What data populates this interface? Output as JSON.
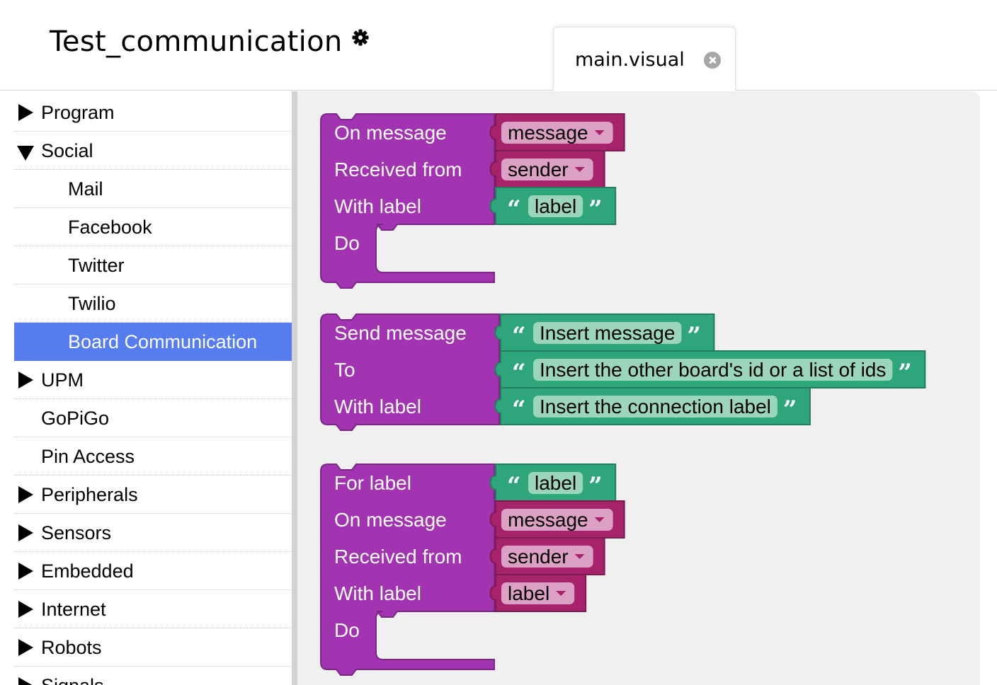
{
  "header": {
    "project_title": "Test_communication",
    "settings_icon": "gear-icon",
    "tab": {
      "label": "main.visual",
      "close_icon": "close-icon"
    }
  },
  "sidebar": {
    "items": [
      {
        "label": "Program",
        "state": "collapsed"
      },
      {
        "label": "Social",
        "state": "expanded"
      },
      {
        "label": "Mail",
        "state": "child"
      },
      {
        "label": "Facebook",
        "state": "child"
      },
      {
        "label": "Twitter",
        "state": "child"
      },
      {
        "label": "Twilio",
        "state": "child"
      },
      {
        "label": "Board Communication",
        "state": "child-selected"
      },
      {
        "label": "UPM",
        "state": "collapsed"
      },
      {
        "label": "GoPiGo",
        "state": "leaf"
      },
      {
        "label": "Pin Access",
        "state": "leaf"
      },
      {
        "label": "Peripherals",
        "state": "collapsed"
      },
      {
        "label": "Sensors",
        "state": "collapsed"
      },
      {
        "label": "Embedded",
        "state": "collapsed"
      },
      {
        "label": "Internet",
        "state": "collapsed"
      },
      {
        "label": "Robots",
        "state": "collapsed"
      },
      {
        "label": "Signals",
        "state": "collapsed"
      }
    ]
  },
  "workspace": {
    "blocks": [
      {
        "name": "on-message-block",
        "rows": [
          {
            "label": "On message",
            "input": {
              "type": "variable",
              "value": "message"
            }
          },
          {
            "label": "Received from",
            "input": {
              "type": "variable",
              "value": "sender"
            }
          },
          {
            "label": "With label",
            "input": {
              "type": "text",
              "value": "label"
            }
          },
          {
            "label": "Do",
            "input": {
              "type": "statement"
            }
          }
        ]
      },
      {
        "name": "send-message-block",
        "rows": [
          {
            "label": "Send message",
            "input": {
              "type": "text",
              "value": "Insert message"
            }
          },
          {
            "label": "To",
            "input": {
              "type": "text",
              "value": "Insert the other board's id or a list of ids"
            }
          },
          {
            "label": "With label",
            "input": {
              "type": "text",
              "value": "Insert the connection label"
            }
          }
        ]
      },
      {
        "name": "for-label-block",
        "rows": [
          {
            "label": "For label",
            "input": {
              "type": "text",
              "value": "label"
            }
          },
          {
            "label": "On message",
            "input": {
              "type": "variable",
              "value": "message"
            }
          },
          {
            "label": "Received from",
            "input": {
              "type": "variable",
              "value": "sender"
            }
          },
          {
            "label": "With label",
            "input": {
              "type": "variable",
              "value": "label"
            }
          },
          {
            "label": "Do",
            "input": {
              "type": "statement"
            }
          }
        ]
      }
    ],
    "quote_open": "“",
    "quote_close": "”"
  },
  "colors": {
    "event_block": "#a234b1",
    "variable_block": "#a6226a",
    "variable_field": "#dca0c4",
    "text_block": "#2ea57a",
    "text_field": "#9bd5bb",
    "selected_item": "#557df0",
    "workspace": "#f0f0f0"
  }
}
